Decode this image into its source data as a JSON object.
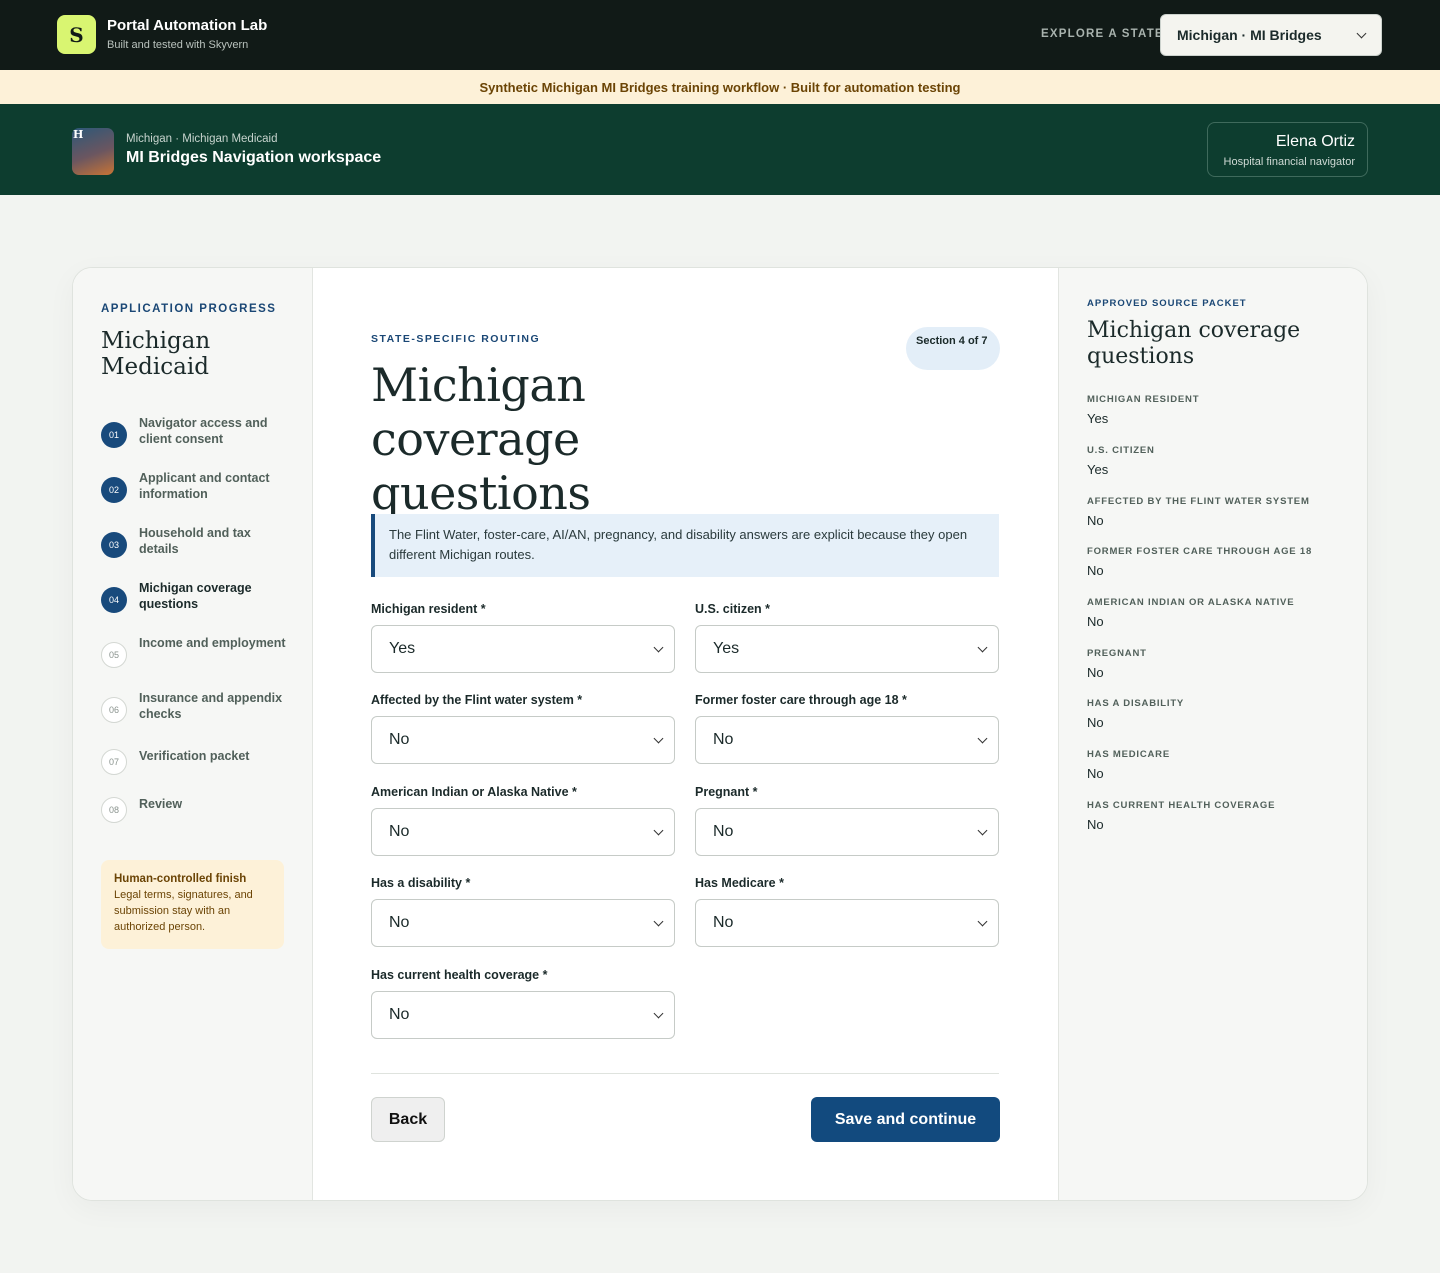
{
  "topbar": {
    "logo_letter": "S",
    "brand_title": "Portal Automation Lab",
    "brand_subtitle": "Built and tested with Skyvern",
    "explore_label": "EXPLORE A STATE",
    "state_selected": "Michigan · MI Bridges"
  },
  "banner": {
    "text": "Synthetic Michigan MI Bridges training workflow · Built for automation testing"
  },
  "workspace": {
    "avatar_letter": "H",
    "breadcrumb": "Michigan · Michigan Medicaid",
    "title": "MI Bridges Navigation workspace",
    "user_name": "Elena Ortiz",
    "user_role": "Hospital financial navigator"
  },
  "progress": {
    "kicker": "APPLICATION PROGRESS",
    "title": "Michigan Medicaid",
    "steps": [
      {
        "num": "01",
        "label": "Navigator access and client consent",
        "state": "done"
      },
      {
        "num": "02",
        "label": "Applicant and contact information",
        "state": "done"
      },
      {
        "num": "03",
        "label": "Household and tax details",
        "state": "done"
      },
      {
        "num": "04",
        "label": "Michigan coverage questions",
        "state": "current"
      },
      {
        "num": "05",
        "label": "Income and employment",
        "state": "todo"
      },
      {
        "num": "06",
        "label": "Insurance and appendix checks",
        "state": "todo"
      },
      {
        "num": "07",
        "label": "Verification packet",
        "state": "todo"
      },
      {
        "num": "08",
        "label": "Review",
        "state": "todo"
      }
    ],
    "note_title": "Human-controlled finish",
    "note_body": "Legal terms, signatures, and submission stay with an authorized person."
  },
  "main": {
    "kicker": "STATE-SPECIFIC ROUTING",
    "section_badge": "Section 4 of 7",
    "title": "Michigan coverage questions",
    "info": "The Flint Water, foster-care, AI/AN, pregnancy, and disability answers are explicit because they open different Michigan routes.",
    "fields": [
      {
        "label": "Michigan resident *",
        "value": "Yes"
      },
      {
        "label": "U.S. citizen *",
        "value": "Yes"
      },
      {
        "label": "Affected by the Flint water system *",
        "value": "No"
      },
      {
        "label": "Former foster care through age 18 *",
        "value": "No"
      },
      {
        "label": "American Indian or Alaska Native *",
        "value": "No"
      },
      {
        "label": "Pregnant *",
        "value": "No"
      },
      {
        "label": "Has a disability *",
        "value": "No"
      },
      {
        "label": "Has Medicare *",
        "value": "No"
      },
      {
        "label": "Has current health coverage *",
        "value": "No"
      }
    ],
    "back_label": "Back",
    "save_label": "Save and continue"
  },
  "source_packet": {
    "kicker": "APPROVED SOURCE PACKET",
    "title": "Michigan coverage questions",
    "items": [
      {
        "key": "MICHIGAN RESIDENT",
        "value": "Yes"
      },
      {
        "key": "U.S. CITIZEN",
        "value": "Yes"
      },
      {
        "key": "AFFECTED BY THE FLINT WATER SYSTEM",
        "value": "No"
      },
      {
        "key": "FORMER FOSTER CARE THROUGH AGE 18",
        "value": "No"
      },
      {
        "key": "AMERICAN INDIAN OR ALASKA NATIVE",
        "value": "No"
      },
      {
        "key": "PREGNANT",
        "value": "No"
      },
      {
        "key": "HAS A DISABILITY",
        "value": "No"
      },
      {
        "key": "HAS MEDICARE",
        "value": "No"
      },
      {
        "key": "HAS CURRENT HEALTH COVERAGE",
        "value": "No"
      }
    ]
  }
}
